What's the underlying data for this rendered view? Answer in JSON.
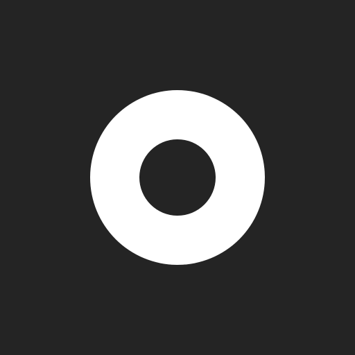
{
  "app": {
    "icon": "ring-icon",
    "colors": {
      "background": "#242424",
      "ring": "#ffffff"
    }
  }
}
